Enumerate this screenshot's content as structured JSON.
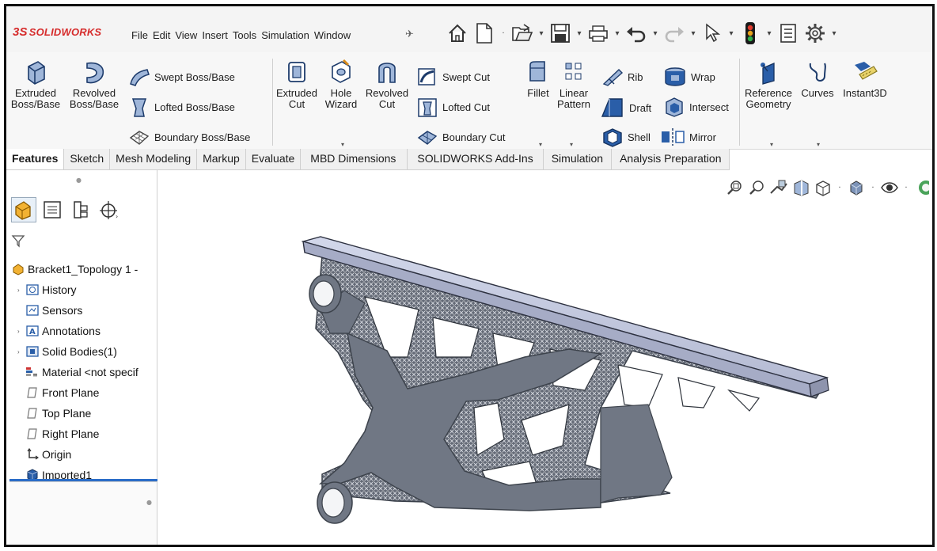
{
  "app": {
    "logo_prefix": "3S",
    "logo_text": "SOLIDWORKS"
  },
  "menu": [
    "File",
    "Edit",
    "View",
    "Insert",
    "Tools",
    "Simulation",
    "Window"
  ],
  "quick_access_icons": [
    "home-icon",
    "new-document-icon",
    "open-icon",
    "save-icon",
    "print-icon",
    "undo-icon",
    "redo-icon",
    "select-icon",
    "traffic-light-icon",
    "file-properties-icon",
    "options-gear-icon"
  ],
  "ribbon": {
    "extruded_boss": [
      "Extruded",
      "Boss/Base"
    ],
    "revolved_boss": [
      "Revolved",
      "Boss/Base"
    ],
    "swept_boss": "Swept Boss/Base",
    "lofted_boss": "Lofted Boss/Base",
    "boundary_boss": "Boundary Boss/Base",
    "extruded_cut": [
      "Extruded",
      "Cut"
    ],
    "hole_wizard": [
      "Hole",
      "Wizard"
    ],
    "revolved_cut": [
      "Revolved",
      "Cut"
    ],
    "swept_cut": "Swept Cut",
    "lofted_cut": "Lofted Cut",
    "boundary_cut": "Boundary Cut",
    "fillet": "Fillet",
    "linear_pattern": [
      "Linear",
      "Pattern"
    ],
    "rib": "Rib",
    "wrap": "Wrap",
    "draft": "Draft",
    "intersect": "Intersect",
    "shell": "Shell",
    "mirror": "Mirror",
    "reference_geometry": [
      "Reference",
      "Geometry"
    ],
    "curves": "Curves",
    "instant3d": "Instant3D"
  },
  "tabs": [
    "Features",
    "Sketch",
    "Mesh Modeling",
    "Markup",
    "Evaluate",
    "MBD Dimensions",
    "SOLIDWORKS Add-Ins",
    "Simulation",
    "Analysis Preparation"
  ],
  "active_tab": "Features",
  "tree": {
    "root": "Bracket1_Topology 1 -",
    "items": [
      {
        "label": "History",
        "icon": "history-folder-icon",
        "expandable": true
      },
      {
        "label": "Sensors",
        "icon": "sensors-icon",
        "expandable": false
      },
      {
        "label": "Annotations",
        "icon": "annotations-icon",
        "expandable": true
      },
      {
        "label": "Solid Bodies(1)",
        "icon": "solid-bodies-icon",
        "expandable": true
      },
      {
        "label": "Material <not specif",
        "icon": "material-icon",
        "expandable": false
      },
      {
        "label": "Front Plane",
        "icon": "plane-icon",
        "expandable": false
      },
      {
        "label": "Top Plane",
        "icon": "plane-icon",
        "expandable": false
      },
      {
        "label": "Right Plane",
        "icon": "plane-icon",
        "expandable": false
      },
      {
        "label": "Origin",
        "icon": "origin-icon",
        "expandable": false
      },
      {
        "label": "Imported1",
        "icon": "imported-body-icon",
        "expandable": false
      }
    ]
  },
  "colors": {
    "logo_red": "#d62c2c",
    "accent_blue": "#2a6cc7",
    "model_gray": "#707784",
    "top_plate": "#b9bfd6"
  }
}
